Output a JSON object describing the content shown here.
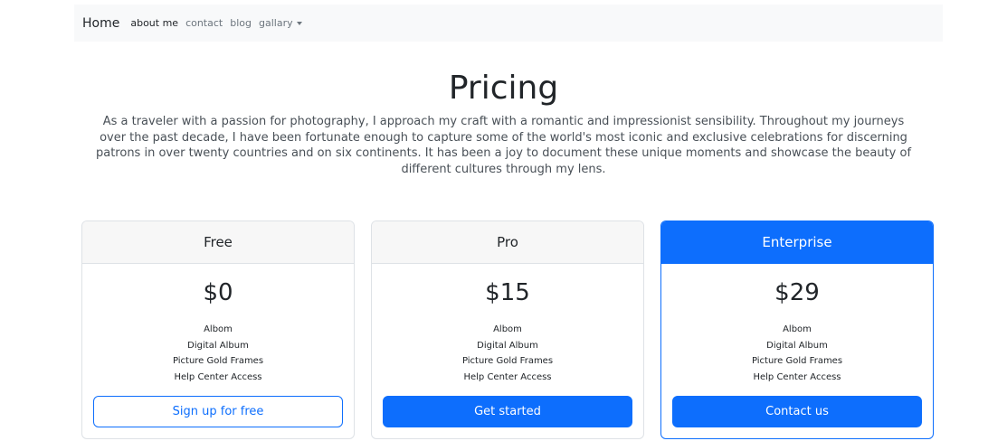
{
  "navbar": {
    "brand": "Home",
    "links": [
      {
        "label": "about me",
        "active": true
      },
      {
        "label": "contact",
        "active": false
      },
      {
        "label": "blog",
        "active": false
      },
      {
        "label": "gallary",
        "active": false,
        "dropdown": true
      }
    ]
  },
  "header": {
    "title": "Pricing",
    "lead": "As a traveler with a passion for photography, I approach my craft with a romantic and impressionist sensibility. Throughout my journeys over the past decade, I have been fortunate enough to capture some of the world's most iconic and exclusive celebrations for discerning patrons in over twenty countries and on six continents. It has been a joy to document these unique moments and showcase the beauty of different cultures through my lens."
  },
  "plans": [
    {
      "name": "Free",
      "price": "$0",
      "features": [
        "Albom",
        "Digital Album",
        "Picture Gold Frames",
        "Help Center Access"
      ],
      "button": "Sign up for free",
      "button_style": "outline"
    },
    {
      "name": "Pro",
      "price": "$15",
      "features": [
        "Albom",
        "Digital Album",
        "Picture Gold Frames",
        "Help Center Access"
      ],
      "button": "Get started",
      "button_style": "solid"
    },
    {
      "name": "Enterprise",
      "price": "$29",
      "features": [
        "Albom",
        "Digital Album",
        "Picture Gold Frames",
        "Help Center Access"
      ],
      "button": "Contact us",
      "button_style": "solid",
      "highlighted": true
    }
  ],
  "colors": {
    "primary": "#0d6efd",
    "navbar_bg": "#f8f9fa",
    "card_header_bg": "#f7f7f7",
    "text": "#212529",
    "muted": "#6c757d"
  }
}
